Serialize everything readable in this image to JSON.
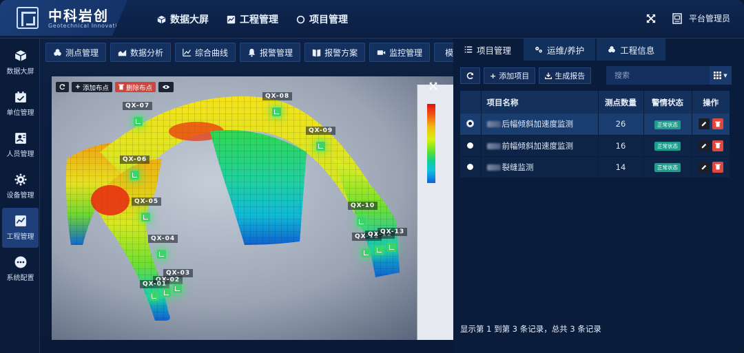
{
  "brand": {
    "title": "中科岩创",
    "subtitle": "Geotechnical Innovation"
  },
  "topnav": [
    {
      "label": "数据大屏",
      "icon": "cube-icon"
    },
    {
      "label": "工程管理",
      "icon": "chart-icon"
    },
    {
      "label": "项目管理",
      "icon": "circle-icon"
    }
  ],
  "header": {
    "user": "平台管理员"
  },
  "sidebar": [
    {
      "label": "数据大屏",
      "icon": "cube-icon"
    },
    {
      "label": "单位管理",
      "icon": "calendar-icon"
    },
    {
      "label": "人员管理",
      "icon": "user-card-icon"
    },
    {
      "label": "设备管理",
      "icon": "gear-icon"
    },
    {
      "label": "工程管理",
      "icon": "chart-icon",
      "active": true
    },
    {
      "label": "系统配置",
      "icon": "more-icon"
    }
  ],
  "toolbar": [
    "测点管理",
    "数据分析",
    "综合曲线",
    "报警管理",
    "报警方案",
    "监控管理",
    "模型展示"
  ],
  "viewer": {
    "refresh_label": "",
    "add_label": "添加布点",
    "delete_label": "删除布点",
    "points": [
      {
        "label": "QX-07"
      },
      {
        "label": "QX-08"
      },
      {
        "label": "QX-09"
      },
      {
        "label": "QX-06"
      },
      {
        "label": "QX-05"
      },
      {
        "label": "QX-04"
      },
      {
        "label": "QX-03"
      },
      {
        "label": "QX-02"
      },
      {
        "label": "QX-01"
      },
      {
        "label": "QX-10"
      },
      {
        "label": "QX-11"
      },
      {
        "label": "QX-12"
      },
      {
        "label": "QX-13"
      }
    ]
  },
  "right_tabs": [
    "项目管理",
    "运维/养护",
    "工程信息"
  ],
  "right_toolbar": {
    "add": "添加项目",
    "report": "生成报告"
  },
  "search": {
    "placeholder": "搜索"
  },
  "table": {
    "headers": [
      "项目名称",
      "测点数量",
      "警情状态",
      "操作"
    ],
    "rows": [
      {
        "name": "后幅倾斜加速度监测",
        "count": "26",
        "status": "正常状态",
        "selected": true
      },
      {
        "name": "前幅倾斜加速度监测",
        "count": "16",
        "status": "正常状态",
        "selected": false
      },
      {
        "name": "裂缝监测",
        "count": "14",
        "status": "正常状态",
        "selected": false
      }
    ]
  },
  "pagination": {
    "text": "显示第 1 到第 3 条记录，总共 3 条记录"
  },
  "colors": {
    "accent": "#1e3f7a",
    "badge": "#1e9c8c",
    "danger": "#e0473e"
  }
}
